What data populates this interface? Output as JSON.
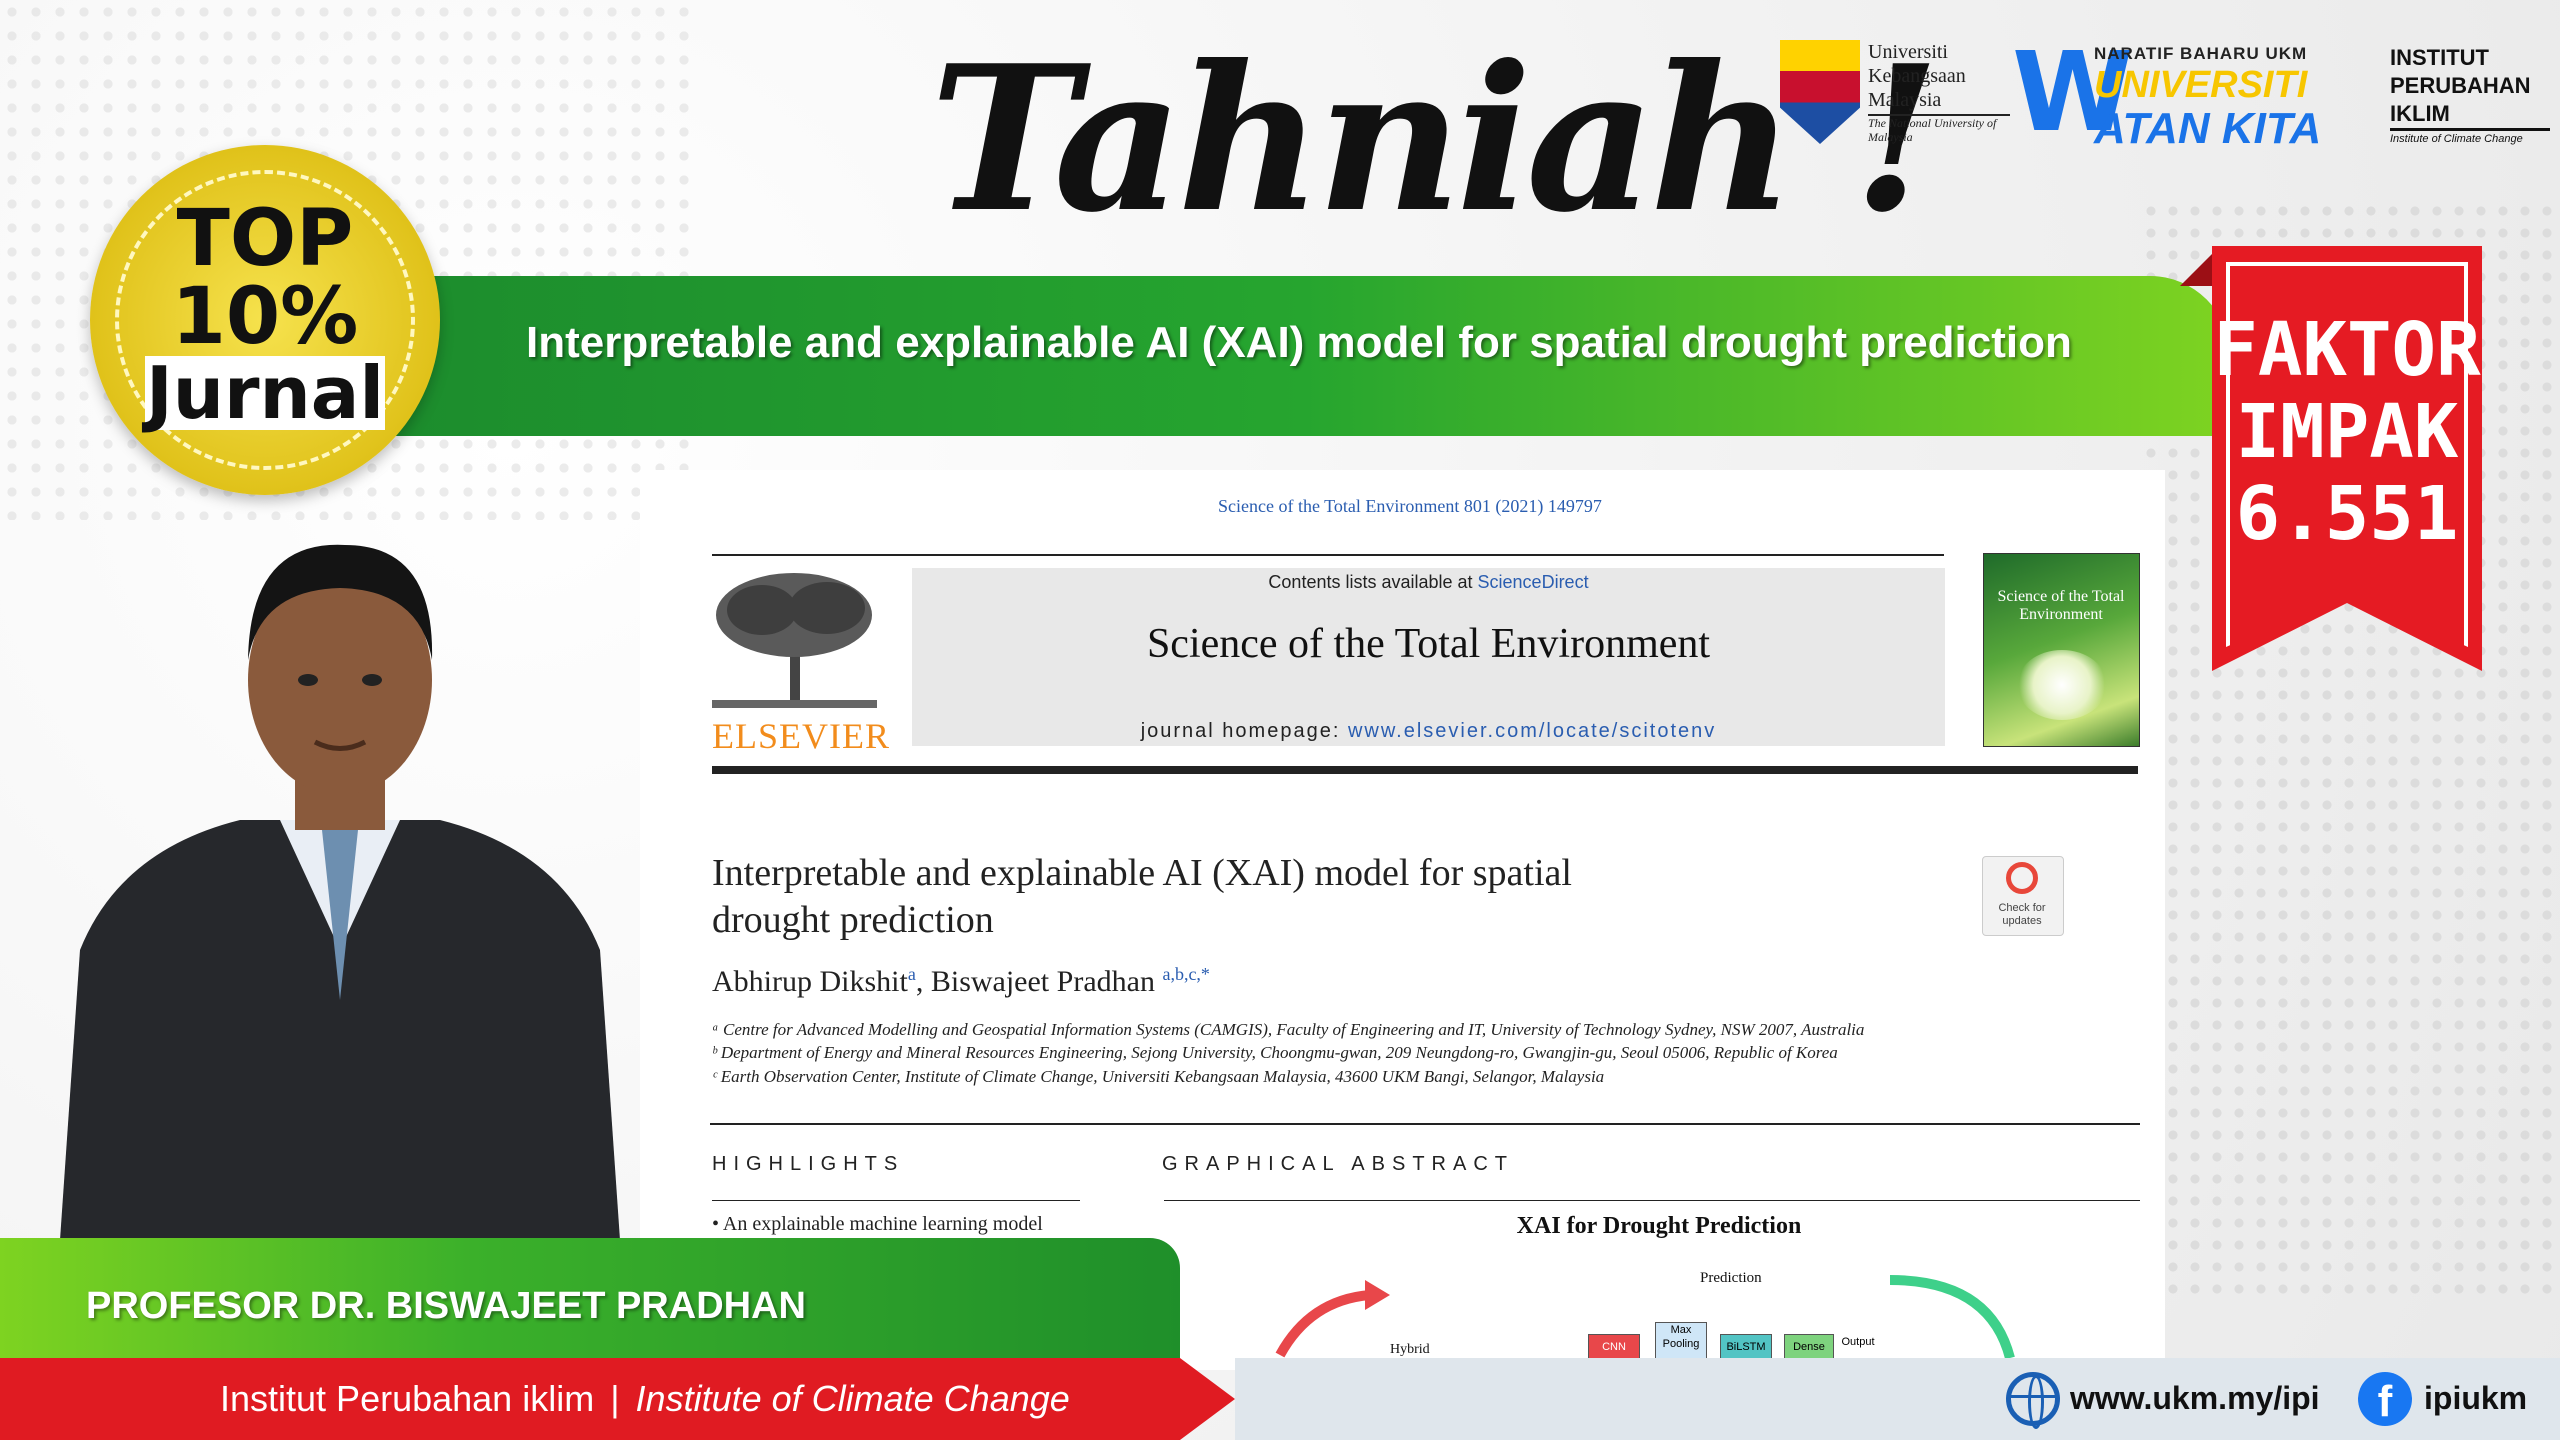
{
  "headline": "Tahniah !",
  "logos": {
    "ukm": {
      "line1": "Universiti",
      "line2": "Kebangsaan",
      "line3": "Malaysia",
      "sub": "The National University of Malaysia"
    },
    "watan": {
      "top": "NARATIF BAHARU UKM",
      "mid": "UNIVERSITI",
      "bot": "ATAN KITA",
      "w": "W"
    },
    "ipi": {
      "line1": "INSTITUT",
      "line2": "PERUBAHAN",
      "line3": "IKLIM",
      "sub": "Institute of Climate Change"
    }
  },
  "banner_title": "Interpretable and explainable AI (XAI) model for spatial drought prediction",
  "seal": {
    "line1": "TOP",
    "line2": "10%",
    "line3": "Jurnal"
  },
  "ribbon": {
    "line1": "FAKTOR",
    "line2": "IMPAK",
    "line3": "6.551"
  },
  "paper": {
    "journal_ref": "Science of the Total Environment 801 (2021) 149797",
    "contents_prefix": "Contents lists available at ",
    "contents_link": "ScienceDirect",
    "journal_title": "Science of the Total Environment",
    "homepage_prefix": "journal homepage: ",
    "homepage_url": "www.elsevier.com/locate/scitotenv",
    "publisher": "ELSEVIER",
    "cover_title": "Science of the Total Environment",
    "title_line1": "Interpretable and explainable AI (XAI) model for spatial",
    "title_line2": "drought prediction",
    "check_updates": "Check for updates",
    "author1": "Abhirup Dikshit",
    "author1_sup": "a",
    "author2": ", Biswajeet Pradhan",
    "author2_sup": "a,b,c,*",
    "affiliations": [
      "ᵃ Centre for Advanced Modelling and Geospatial Information Systems (CAMGIS), Faculty of Engineering and IT, University of Technology Sydney, NSW 2007, Australia",
      "ᵇ Department of Energy and Mineral Resources Engineering, Sejong University, Choongmu-gwan, 209 Neungdong-ro, Gwangjin-gu, Seoul 05006, Republic of Korea",
      "ᶜ Earth Observation Center, Institute of Climate Change, Universiti Kebangsaan Malaysia, 43600 UKM Bangi, Selangor, Malaysia"
    ],
    "highlights_heading": "HIGHLIGHTS",
    "graphical_heading": "GRAPHICAL ABSTRACT",
    "highlight1": "• An explainable machine learning model",
    "ga_title": "XAI for Drought Prediction",
    "ga_prediction": "Prediction",
    "ga_hybrid": "Hybrid",
    "ga_boxes": [
      "CNN",
      "Max Pooling",
      "BiLSTM",
      "Dense",
      "Output"
    ]
  },
  "person_name": "PROFESOR DR. BISWAJEET PRADHAN",
  "institute_ms": "Institut Perubahan iklim",
  "institute_sep": "|",
  "institute_en": "Institute of Climate Change",
  "website": "www.ukm.my/ipi",
  "facebook": "ipiukm",
  "colors": {
    "green": "#26a52f",
    "red": "#e01b22",
    "gold": "#e0c21a",
    "link": "#2a5db0"
  }
}
